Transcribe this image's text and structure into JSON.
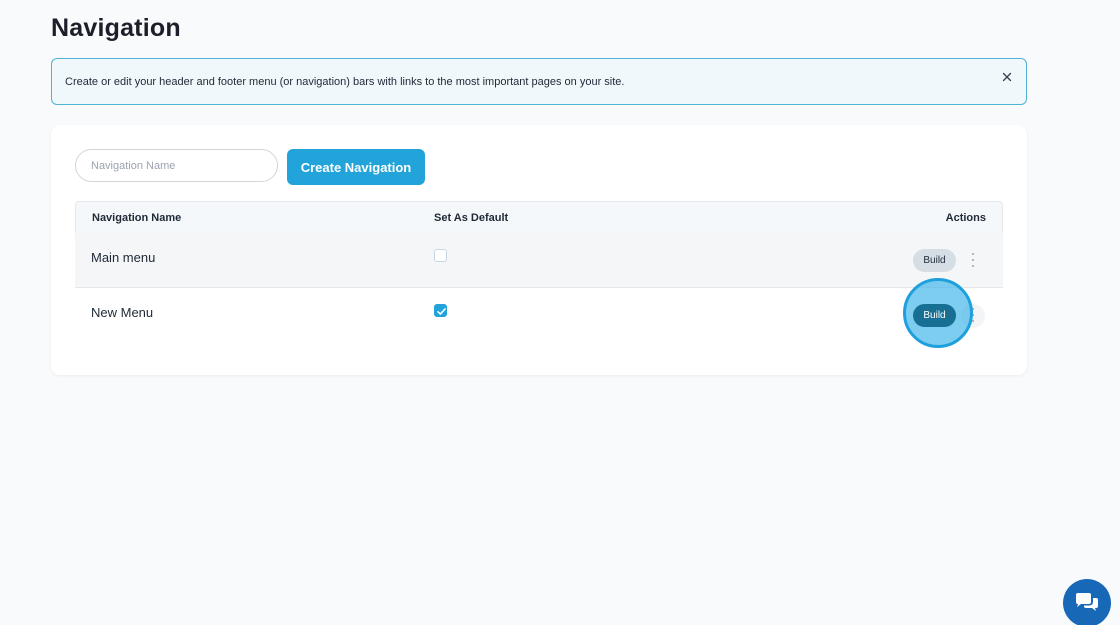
{
  "page": {
    "title": "Navigation"
  },
  "banner": {
    "text": "Create or edit your header and footer menu (or navigation) bars with links to the most important pages on your site.",
    "close_icon": "close-icon"
  },
  "toolbar": {
    "name_placeholder": "Navigation Name",
    "name_value": "",
    "create_label": "Create Navigation"
  },
  "table": {
    "headers": {
      "name": "Navigation Name",
      "default": "Set As Default",
      "actions": "Actions"
    },
    "rows": [
      {
        "name": "Main menu",
        "is_default": false,
        "build_label": "Build"
      },
      {
        "name": "New Menu",
        "is_default": true,
        "build_label": "Build"
      }
    ]
  },
  "chat": {
    "icon": "chat-bubbles-icon"
  },
  "colors": {
    "accent": "#22a3d9",
    "build_active": "#176f94",
    "banner_border": "#4fb3d4",
    "chat": "#1769b8"
  }
}
